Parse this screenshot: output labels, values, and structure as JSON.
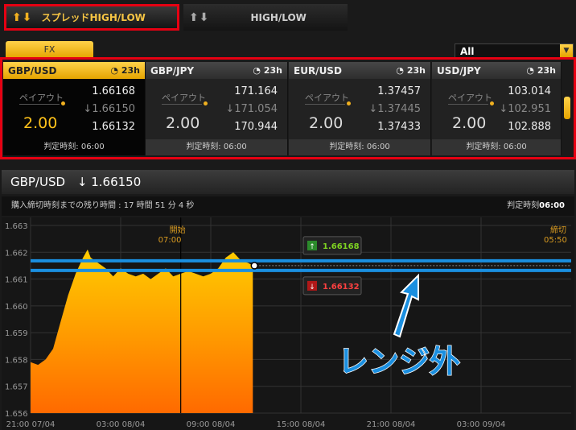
{
  "tabs": {
    "spread": "スプレッドHIGH/LOW",
    "highlow": "HIGH/LOW"
  },
  "fx_tab": "FX",
  "filter": {
    "selected": "All"
  },
  "cards": [
    {
      "pair": "GBP/USD",
      "time": "23h",
      "payout_label": "ペイアウト",
      "payout": "2.00",
      "high": "1.66168",
      "mid": "1.66150",
      "low": "1.66132",
      "judge": "判定時刻: 06:00",
      "active": true
    },
    {
      "pair": "GBP/JPY",
      "time": "23h",
      "payout_label": "ペイアウト",
      "payout": "2.00",
      "high": "171.164",
      "mid": "171.054",
      "low": "170.944",
      "judge": "判定時刻: 06:00",
      "active": false
    },
    {
      "pair": "EUR/USD",
      "time": "23h",
      "payout_label": "ペイアウト",
      "payout": "2.00",
      "high": "1.37457",
      "mid": "1.37445",
      "low": "1.37433",
      "judge": "判定時刻: 06:00",
      "active": false
    },
    {
      "pair": "USD/JPY",
      "time": "23h",
      "payout_label": "ペイアウト",
      "payout": "2.00",
      "high": "103.014",
      "mid": "102.951",
      "low": "102.888",
      "judge": "判定時刻: 06:00",
      "active": false
    }
  ],
  "chart_header": {
    "pair": "GBP/USD",
    "rate": "1.66150"
  },
  "chart_sub": {
    "countdown": "購入締切時刻までの残り時間 : 17 時間 51 分 4 秒",
    "judge_label": "判定時刻",
    "judge_time": "06:00"
  },
  "chart_data": {
    "type": "area",
    "y_ticks": [
      "1.663",
      "1.662",
      "1.661",
      "1.660",
      "1.659",
      "1.658",
      "1.657",
      "1.656"
    ],
    "ylim": [
      1.656,
      1.6633
    ],
    "x_ticks": [
      "21:00 07/04",
      "03:00 08/04",
      "09:00 08/04",
      "15:00 08/04",
      "21:00 08/04",
      "03:00 09/04"
    ],
    "x_range_hours": [
      0,
      36
    ],
    "start_marker": {
      "label": "開始",
      "time": "07:00",
      "hour": 10
    },
    "end_marker": {
      "label": "締切",
      "time": "05:50",
      "hour": 32.8
    },
    "high_box": "1.66168",
    "low_box": "1.66132",
    "high_value": 1.66168,
    "low_value": 1.66132,
    "current_value": 1.6615,
    "series": [
      {
        "values": [
          [
            0,
            1.6579
          ],
          [
            0.5,
            1.6578
          ],
          [
            1,
            1.658
          ],
          [
            1.5,
            1.6584
          ],
          [
            2,
            1.6594
          ],
          [
            2.5,
            1.6604
          ],
          [
            3,
            1.6612
          ],
          [
            3.5,
            1.6618
          ],
          [
            3.8,
            1.6621
          ],
          [
            4,
            1.6618
          ],
          [
            4.5,
            1.6616
          ],
          [
            5,
            1.6614
          ],
          [
            5.5,
            1.6611
          ],
          [
            6,
            1.6614
          ],
          [
            6.5,
            1.6612
          ],
          [
            7,
            1.6611
          ],
          [
            7.5,
            1.6612
          ],
          [
            8,
            1.661
          ],
          [
            8.5,
            1.6612
          ],
          [
            9,
            1.6614
          ],
          [
            9.5,
            1.6611
          ],
          [
            10,
            1.6612
          ],
          [
            10.5,
            1.6613
          ],
          [
            11,
            1.6612
          ],
          [
            11.5,
            1.6611
          ],
          [
            12,
            1.6612
          ],
          [
            12.5,
            1.6614
          ],
          [
            13,
            1.6618
          ],
          [
            13.5,
            1.662
          ],
          [
            14,
            1.6617
          ],
          [
            14.5,
            1.6616
          ],
          [
            14.8,
            1.6615
          ]
        ]
      }
    ]
  },
  "annotation": "レンジ外",
  "colors": {
    "accent": "#f0b020",
    "frame_red": "#e60012",
    "range_line": "#1a8fe0",
    "high_green": "#7ed321",
    "low_red": "#ff4040"
  }
}
